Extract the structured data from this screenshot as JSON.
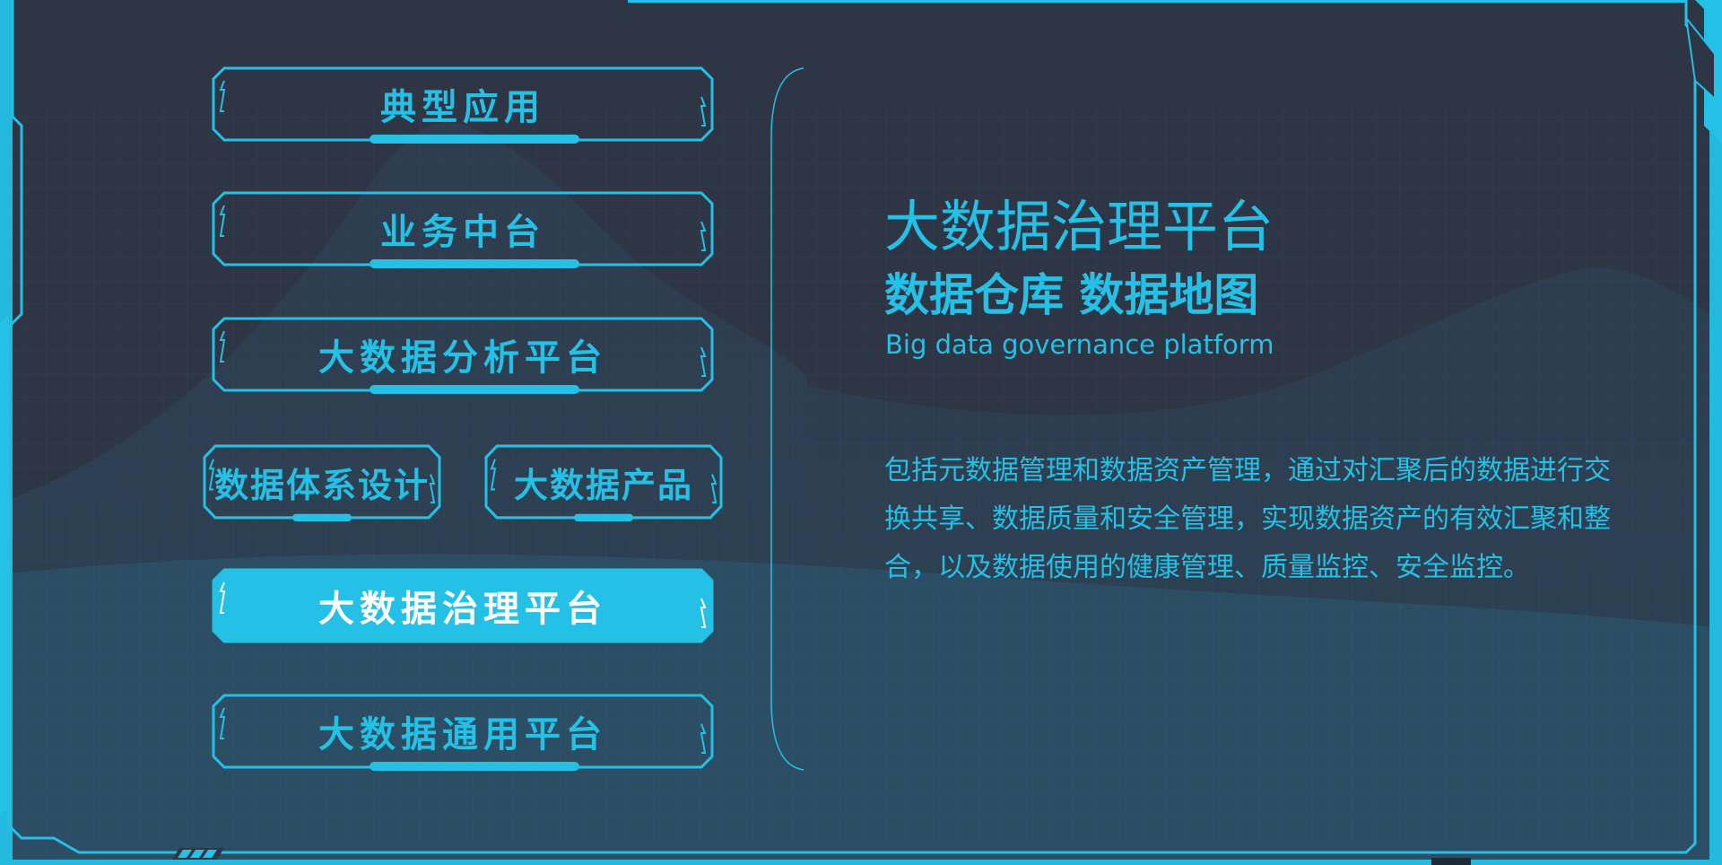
{
  "menu": {
    "items": [
      {
        "label": "典型应用",
        "active": false
      },
      {
        "label": "业务中台",
        "active": false
      },
      {
        "label": "大数据分析平台",
        "active": false
      },
      {
        "label": "数据体系设计",
        "active": false
      },
      {
        "label": "大数据产品",
        "active": false
      },
      {
        "label": "大数据治理平台",
        "active": true
      },
      {
        "label": "大数据通用平台",
        "active": false
      }
    ]
  },
  "detail": {
    "title": "大数据治理平台",
    "subtitle": "数据仓库 数据地图",
    "english_title": "Big data governance platform",
    "description": "包括元数据管理和数据资产管理，通过对汇聚后的数据进行交换共享、数据质量和安全管理，实现数据资产的有效汇聚和整合，以及数据使用的健康管理、质量监控、安全监控。"
  },
  "colors": {
    "accent": "#24c0e6",
    "background": "#2e3545",
    "active_fill": "#24c0e6",
    "active_text": "#ffffff"
  }
}
